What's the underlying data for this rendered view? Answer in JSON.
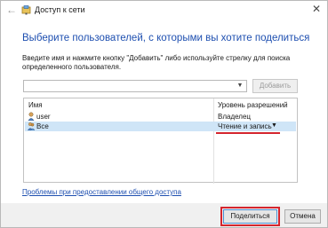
{
  "window": {
    "title": "Доступ к сети"
  },
  "heading": "Выберите пользователей, с которыми вы хотите поделиться",
  "instructions": "Введите имя и нажмите кнопку \"Добавить\" либо используйте стрелку для поиска определенного пользователя.",
  "add_user": {
    "input_value": "",
    "add_label": "Добавить"
  },
  "grid": {
    "headers": {
      "name": "Имя",
      "permission": "Уровень разрешений"
    },
    "rows": [
      {
        "name": "user",
        "permission": "Владелец",
        "selected": false
      },
      {
        "name": "Все",
        "permission": "Чтение и запись",
        "selected": true
      }
    ]
  },
  "help_link": "Проблемы при предоставлении общего доступа",
  "footer": {
    "share_label": "Поделиться",
    "cancel_label": "Отмена"
  },
  "colors": {
    "accent": "#1e4fb0",
    "highlight": "#d4252e",
    "selection": "#cfe5f7"
  }
}
